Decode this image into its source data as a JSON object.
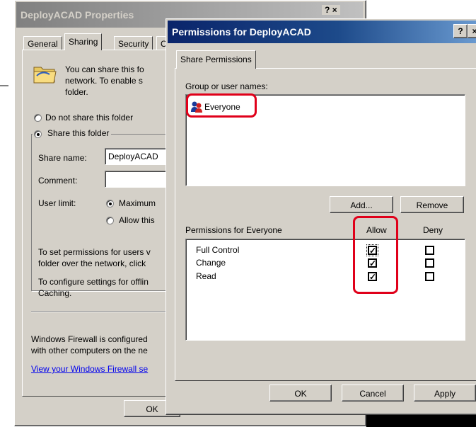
{
  "back_window": {
    "title": "DeployACAD Properties",
    "tabs": [
      "General",
      "Sharing",
      "Security",
      "C"
    ],
    "intro_text": [
      "You can share this fo",
      "network.  To enable s",
      "folder."
    ],
    "radio_not_share": "Do not share this folder",
    "radio_share": "Share this folder",
    "share_name_label": "Share name:",
    "share_name_value": "DeployACAD",
    "comment_label": "Comment:",
    "comment_value": "",
    "user_limit_label": "User limit:",
    "maximum_label": "Maximum",
    "allow_this_label": "Allow this",
    "permissions_text": [
      "To set permissions for users v",
      "folder over the network, click"
    ],
    "offline_text": [
      "To configure settings for offlin",
      "Caching."
    ],
    "firewall_text": [
      "Windows Firewall is configured",
      "with other computers on the ne"
    ],
    "firewall_link": "View your Windows Firewall se",
    "ok_label": "OK",
    "title_buttons": "? ×"
  },
  "dialog": {
    "title": "Permissions for DeployACAD",
    "help_button": "?",
    "close_button": "×",
    "tab_label": "Share Permissions",
    "group_label": "Group or user names:",
    "group_items": [
      {
        "name": "Everyone",
        "icon": "users-group-icon"
      }
    ],
    "add_button": "Add...",
    "remove_button": "Remove",
    "permissions_for_label": "Permissions for Everyone",
    "allow_header": "Allow",
    "deny_header": "Deny",
    "permissions": [
      {
        "name": "Full Control",
        "allow": true,
        "deny": false
      },
      {
        "name": "Change",
        "allow": true,
        "deny": false
      },
      {
        "name": "Read",
        "allow": true,
        "deny": false
      }
    ],
    "ok_button": "OK",
    "cancel_button": "Cancel",
    "apply_button": "Apply"
  },
  "colors": {
    "highlight_red": "#e0001a",
    "title_active": "#0a246a",
    "title_inactive": "#808080",
    "face": "#d4d0c8",
    "link": "#0000ee"
  }
}
